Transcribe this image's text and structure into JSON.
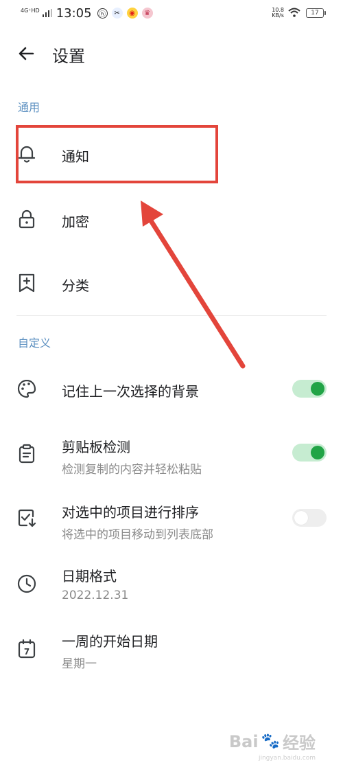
{
  "status_bar": {
    "network": "4G⁺HD",
    "time": "13:05",
    "speed_value": "10.8",
    "speed_unit": "KB/s",
    "battery": "17"
  },
  "header": {
    "title": "设置"
  },
  "sections": {
    "general": "通用",
    "custom": "自定义"
  },
  "items": {
    "notification": {
      "label": "通知",
      "icon": "bell-icon"
    },
    "encryption": {
      "label": "加密",
      "icon": "lock-icon"
    },
    "category": {
      "label": "分类",
      "icon": "bookmark-plus-icon"
    },
    "background": {
      "label": "记住上一次选择的背景",
      "icon": "palette-icon",
      "toggle": true
    },
    "clipboard": {
      "label": "剪贴板检测",
      "sub": "检测复制的内容并轻松粘贴",
      "icon": "clipboard-icon",
      "toggle": true
    },
    "sort": {
      "label": "对选中的项目进行排序",
      "sub": "将选中的项目移动到列表底部",
      "icon": "checkbox-sort-icon",
      "toggle": false
    },
    "date_format": {
      "label": "日期格式",
      "sub": "2022.12.31",
      "icon": "clock-icon"
    },
    "week_start": {
      "label": "一周的开始日期",
      "sub": "星期一",
      "icon": "calendar-icon",
      "icon_text": "7"
    }
  },
  "watermark": {
    "brand_left": "Bai",
    "brand_right": "经验",
    "domain": "jingyan.baidu.com"
  },
  "colors": {
    "accent_green": "#21a446",
    "section_blue": "#5b8fc0",
    "annotation_red": "#e3453b"
  }
}
